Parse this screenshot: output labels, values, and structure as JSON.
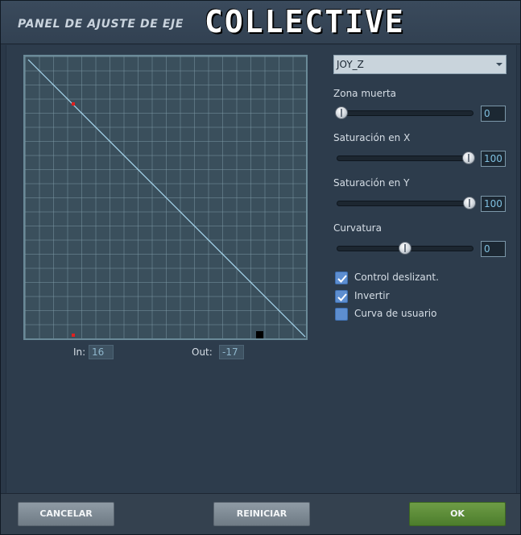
{
  "header": {
    "panel_title": "PANEL DE AJUSTE DE EJE",
    "axis_name": "COLLECTIVE"
  },
  "graph": {
    "in_label": "In:",
    "in_value": "16",
    "out_label": "Out:",
    "out_value": "-17",
    "line_color": "#a8d8f0",
    "marker_color": "#e02020"
  },
  "controls": {
    "axis_select": {
      "value": "JOY_Z"
    },
    "deadzone": {
      "label": "Zona muerta",
      "value": "0",
      "level": 0.0
    },
    "saturation_x": {
      "label": "Saturación en X",
      "value": "100",
      "level": 1.0
    },
    "saturation_y": {
      "label": "Saturación en Y",
      "value": "100",
      "level": 1.0
    },
    "curvature": {
      "label": "Curvatura",
      "value": "0",
      "level": 0.5
    },
    "slider_control": {
      "label": "Control deslizant.",
      "checked": true
    },
    "invert": {
      "label": "Invertir",
      "checked": true
    },
    "user_curve": {
      "label": "Curva de usuario",
      "checked": false
    }
  },
  "footer": {
    "cancel_label": "CANCELAR",
    "reset_label": "REINICIAR",
    "ok_label": "OK"
  }
}
